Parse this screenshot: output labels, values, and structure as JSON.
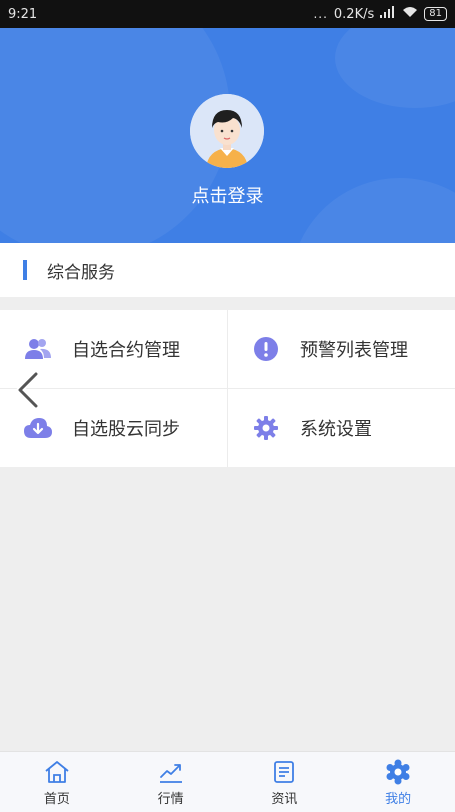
{
  "status": {
    "time": "9:21",
    "dots": "...",
    "speed": "0.2K/s",
    "battery": "81"
  },
  "profile": {
    "login_label": "点击登录"
  },
  "section": {
    "title": "综合服务"
  },
  "services": [
    {
      "label": "自选合约管理",
      "icon": "users-icon"
    },
    {
      "label": "预警列表管理",
      "icon": "alert-icon"
    },
    {
      "label": "自选股云同步",
      "icon": "cloud-sync-icon"
    },
    {
      "label": "系统设置",
      "icon": "gear-icon"
    }
  ],
  "tabs": [
    {
      "label": "首页",
      "icon": "home-icon",
      "active": false
    },
    {
      "label": "行情",
      "icon": "chart-icon",
      "active": false
    },
    {
      "label": "资讯",
      "icon": "news-icon",
      "active": false
    },
    {
      "label": "我的",
      "icon": "profile-icon",
      "active": true
    }
  ],
  "colors": {
    "primary": "#3f7fe5",
    "icon_purple": "#7d7fe8"
  }
}
